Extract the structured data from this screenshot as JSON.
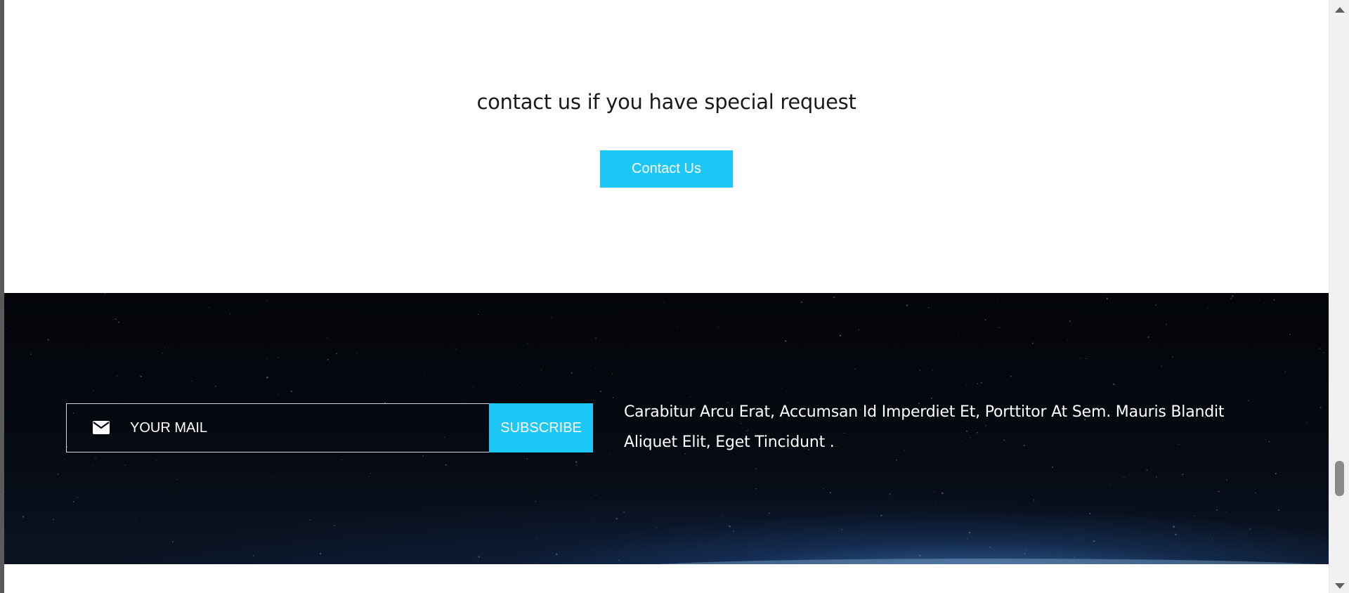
{
  "cta": {
    "heading": "contact us if you have special request",
    "button_label": "Contact Us"
  },
  "newsletter": {
    "icon": "envelope-icon",
    "email_placeholder": "YOUR MAIL",
    "email_value": "",
    "subscribe_label": "SUBSCRIBE"
  },
  "footer": {
    "description": "Carabitur Arcu Erat, Accumsan Id Imperdiet Et, Porttitor At Sem. Mauris Blandit Aliquet Elit, Eget Tincidunt ."
  },
  "colors": {
    "accent": "#1ec8f6",
    "footer_bg": "#05080f",
    "page_bg": "#ffffff"
  },
  "scrollbar": {
    "position_fraction": 0.93
  }
}
